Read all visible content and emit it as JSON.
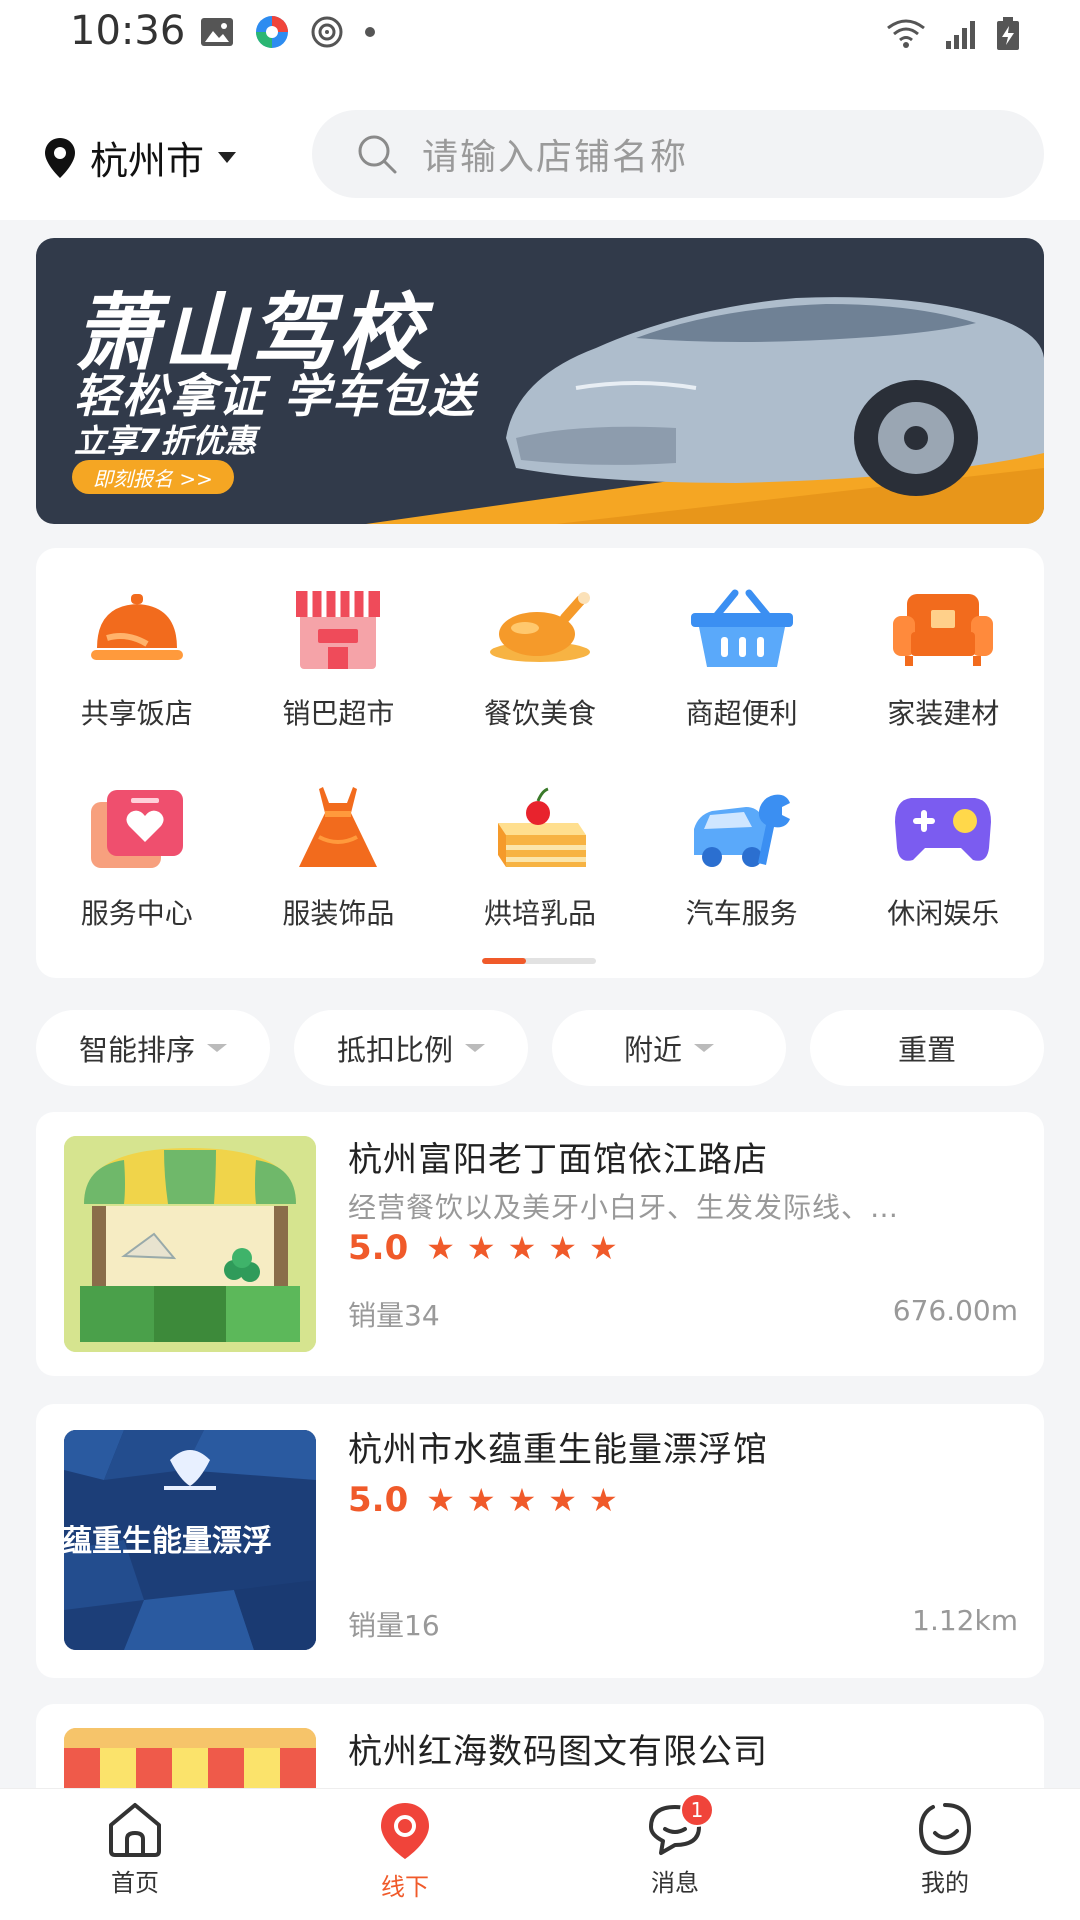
{
  "status_bar": {
    "time": "10:36"
  },
  "header": {
    "city": "杭州市",
    "search_placeholder": "请输入店铺名称"
  },
  "banner": {
    "title": "萧山驾校",
    "subtitle": "轻松拿证 学车包送",
    "offer": "立享7折优惠",
    "cta": "即刻报名 >>"
  },
  "categories": [
    {
      "label": "共享饭店",
      "icon": "dining-cloche-icon"
    },
    {
      "label": "销巴超市",
      "icon": "storefront-icon"
    },
    {
      "label": "餐饮美食",
      "icon": "roast-chicken-icon"
    },
    {
      "label": "商超便利",
      "icon": "shopping-basket-icon"
    },
    {
      "label": "家装建材",
      "icon": "sofa-icon"
    },
    {
      "label": "服务中心",
      "icon": "heart-card-icon"
    },
    {
      "label": "服装饰品",
      "icon": "dress-icon"
    },
    {
      "label": "烘培乳品",
      "icon": "cake-icon"
    },
    {
      "label": "汽车服务",
      "icon": "car-wrench-icon"
    },
    {
      "label": "休闲娱乐",
      "icon": "gamepad-icon"
    }
  ],
  "category_page": {
    "current": 1,
    "total": 2
  },
  "filters": [
    {
      "label": "智能排序",
      "has_caret": true
    },
    {
      "label": "抵扣比例",
      "has_caret": true
    },
    {
      "label": "附近",
      "has_caret": true
    },
    {
      "label": "重置",
      "has_caret": false
    }
  ],
  "stores": [
    {
      "name": "杭州富阳老丁面馆依江路店",
      "desc": "经营餐饮以及美牙小白牙、生发发际线、…",
      "rating": "5.0",
      "stars": 5,
      "sales": "销量34",
      "distance": "676.00m",
      "thumb_text": ""
    },
    {
      "name": "杭州市水蕴重生能量漂浮馆",
      "desc": "",
      "rating": "5.0",
      "stars": 5,
      "sales": "销量16",
      "distance": "1.12km",
      "thumb_text": "蕴重生能量漂浮"
    },
    {
      "name": "杭州红海数码图文有限公司"
    }
  ],
  "tab_bar": {
    "tabs": [
      {
        "label": "首页",
        "icon": "home-icon"
      },
      {
        "label": "线下",
        "icon": "location-pin-icon"
      },
      {
        "label": "消息",
        "icon": "message-icon",
        "badge": "1"
      },
      {
        "label": "我的",
        "icon": "profile-icon"
      }
    ],
    "active_index": 1
  },
  "colors": {
    "accent": "#f05a2a",
    "banner_bg": "#313a4a",
    "banner_cta": "#f5a623"
  }
}
